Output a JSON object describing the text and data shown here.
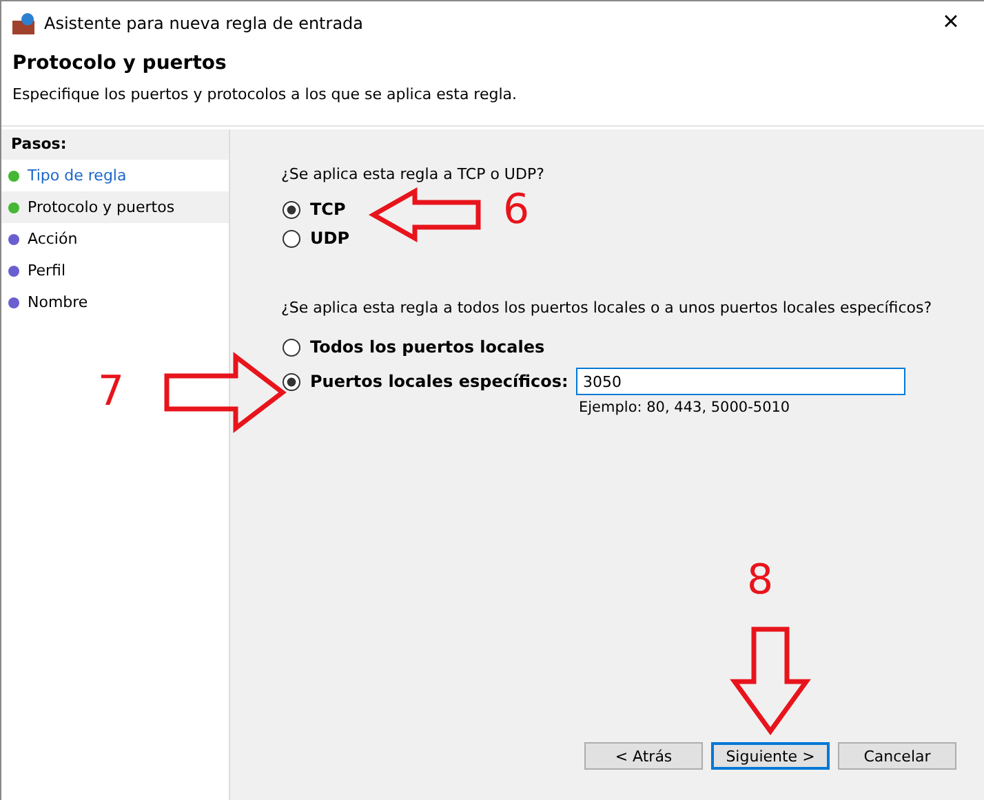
{
  "window": {
    "title": "Asistente para nueva regla de entrada",
    "close": "×"
  },
  "header": {
    "title": "Protocolo y puertos",
    "description": "Especifique los puertos y protocolos a los que se aplica esta regla."
  },
  "steps": {
    "heading": "Pasos:",
    "items": [
      {
        "label": "Tipo de regla",
        "done": true,
        "selected": false
      },
      {
        "label": "Protocolo y puertos",
        "done": true,
        "selected": true
      },
      {
        "label": "Acción",
        "done": false,
        "selected": false
      },
      {
        "label": "Perfil",
        "done": false,
        "selected": false
      },
      {
        "label": "Nombre",
        "done": false,
        "selected": false
      }
    ]
  },
  "protocol": {
    "question": "¿Se aplica esta regla a TCP o UDP?",
    "options": [
      {
        "label": "TCP",
        "selected": true
      },
      {
        "label": "UDP",
        "selected": false
      }
    ]
  },
  "ports": {
    "question": "¿Se aplica esta regla a todos los puertos locales o a unos puertos locales específicos?",
    "options": [
      {
        "label": "Todos los puertos locales",
        "selected": false
      },
      {
        "label": "Puertos locales específicos:",
        "selected": true
      }
    ],
    "value": "3050",
    "example": "Ejemplo: 80, 443, 5000-5010"
  },
  "buttons": [
    {
      "label": "< Atrás",
      "default": false
    },
    {
      "label": "Siguiente >",
      "default": true
    },
    {
      "label": "Cancelar",
      "default": false
    }
  ],
  "annotations": [
    {
      "number": "6",
      "kind": "left"
    },
    {
      "number": "7",
      "kind": "right"
    },
    {
      "number": "8",
      "kind": "down"
    }
  ]
}
